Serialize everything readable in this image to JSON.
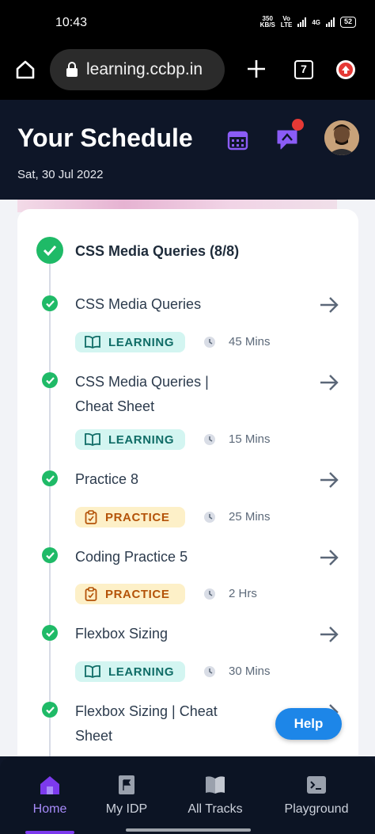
{
  "status_bar": {
    "time": "10:43",
    "net_speed_value": "350",
    "net_speed_unit": "KB/S",
    "volte_top": "Vo",
    "volte_bottom": "LTE",
    "network": "4G",
    "battery": "52"
  },
  "browser": {
    "url": "learning.ccbp.in",
    "tab_count": "7"
  },
  "header": {
    "title": "Your Schedule",
    "date": "Sat, 30 Jul 2022"
  },
  "module": {
    "title": "CSS Media Queries (8/8)"
  },
  "items": [
    {
      "title": "CSS Media Queries",
      "type": "LEARNING",
      "duration": "45 Mins"
    },
    {
      "title": "CSS Media Queries | Cheat Sheet",
      "type": "LEARNING",
      "duration": "15 Mins"
    },
    {
      "title": "Practice 8",
      "type": "PRACTICE",
      "duration": "25 Mins"
    },
    {
      "title": "Coding Practice 5",
      "type": "PRACTICE",
      "duration": "2 Hrs"
    },
    {
      "title": "Flexbox Sizing",
      "type": "LEARNING",
      "duration": "30 Mins"
    },
    {
      "title": "Flexbox Sizing | Cheat Sheet"
    }
  ],
  "help": {
    "label": "Help"
  },
  "nav": {
    "items": [
      {
        "label": "Home",
        "icon": "home-icon",
        "active": true
      },
      {
        "label": "My IDP",
        "icon": "flag-doc-icon"
      },
      {
        "label": "All Tracks",
        "icon": "book-icon"
      },
      {
        "label": "Playground",
        "icon": "terminal-icon"
      }
    ]
  },
  "colors": {
    "accent": "#7c3aed",
    "success": "#1fba67",
    "learning_bg": "#d3f5f1",
    "practice_bg": "#fdf0c8",
    "help": "#1d86e8"
  }
}
